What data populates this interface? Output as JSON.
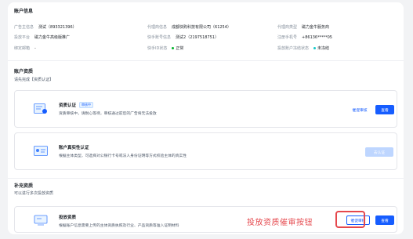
{
  "account_info": {
    "title": "账户信息",
    "rows": [
      [
        {
          "label": "广告主信息",
          "value": "测试（89332139​6）"
        },
        {
          "label": "代理商信息",
          "value": "成都快购科技有限公司（61254）"
        },
        {
          "label": "代理商类型",
          "value": "磁力金牛服务商"
        }
      ],
      [
        {
          "label": "投放平台",
          "value": "磁力金牛高级版推广"
        },
        {
          "label": "快手账号信息",
          "value": "测试2（2197518751）"
        },
        {
          "label": "注册手机号",
          "value": "+86136*****05"
        }
      ],
      [
        {
          "label": "绑定邮箱",
          "value": "-"
        },
        {
          "label": "快手ID状态",
          "value": "正常",
          "status_color": "#00b42a"
        },
        {
          "label": "投放账户冻结状态",
          "value": "未冻结",
          "status_color": "#14c9c9"
        }
      ]
    ]
  },
  "account_qualification": {
    "title": "账户资质",
    "subtitle": "请先完成【资质认证】"
  },
  "cards": {
    "qual_cert": {
      "title": "资质认证",
      "badge": "审核中",
      "desc": "资质审核中，请耐心等待，审核通过前您的广告将无法投放",
      "urge_label": "催促审核",
      "view_label": "查看"
    },
    "real_name": {
      "title": "账户真实性认证",
      "desc": "根据主体类型，可选择对公银行卡号或法人身份证明等方式校验主体的真实性",
      "verify_label": "去认证"
    },
    "delivery_qual": {
      "title": "投放资质",
      "desc": "根据账户信息需要上传的主体资质执照及行业、产品资质等准入证明材料",
      "urge_label": "催促审核",
      "view_label": "查看"
    }
  },
  "supplement": {
    "title": "补充资质",
    "subtitle": "可以进行多次投放资质"
  },
  "annotation": {
    "text": "投放资质催审按钮",
    "color": "#e5484d"
  },
  "colors": {
    "primary": "#165dff",
    "disabled": "#bed6ff"
  }
}
